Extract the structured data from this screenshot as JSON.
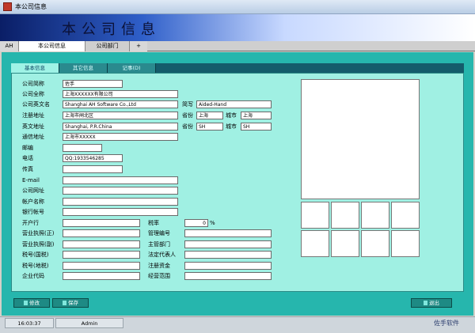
{
  "window": {
    "title": "本公司信息"
  },
  "banner": {
    "title": "本公司信息"
  },
  "main_tabs": [
    {
      "label": "AH"
    },
    {
      "label": "本公司信息"
    },
    {
      "label": "公司部门"
    },
    {
      "label": "+"
    }
  ],
  "sub_tabs": [
    {
      "label": "基本信息"
    },
    {
      "label": "其它信息"
    },
    {
      "label": "记事(D)"
    }
  ],
  "fields": {
    "short_name": {
      "label": "公司简称",
      "value": "佐手"
    },
    "full_name": {
      "label": "公司全称",
      "value": "上海XXXXXX有限公司"
    },
    "english_name": {
      "label": "公司英文名",
      "value": "Shanghai AH Software Co.,Ltd"
    },
    "abbr": {
      "label": "简写",
      "value": "Aided-Hand"
    },
    "reg_address": {
      "label": "注册地址",
      "value": "上海市闸北区"
    },
    "reg_province": {
      "label": "省份",
      "value": "上海"
    },
    "reg_city": {
      "label": "城市",
      "value": "上海"
    },
    "en_address": {
      "label": "英文地址",
      "value": "Shanghai, P.R.China"
    },
    "en_province": {
      "label": "省份",
      "value": "SH"
    },
    "en_city": {
      "label": "城市",
      "value": "SH"
    },
    "mail_address": {
      "label": "通信地址",
      "value": "上海市XXXXX"
    },
    "postcode": {
      "label": "邮编",
      "value": ""
    },
    "phone": {
      "label": "电话",
      "value": "QQ:1933546285"
    },
    "fax": {
      "label": "传真",
      "value": ""
    },
    "email": {
      "label": "E-mail",
      "value": ""
    },
    "website": {
      "label": "公司网址",
      "value": ""
    },
    "account_name": {
      "label": "帐户名称",
      "value": ""
    },
    "bank_account": {
      "label": "银行帐号",
      "value": ""
    },
    "bank": {
      "label": "开户行",
      "value": ""
    },
    "tax_rate": {
      "label": "税率",
      "value": "0",
      "unit": "%"
    },
    "license_main": {
      "label": "营业执照(正)",
      "value": ""
    },
    "mgmt_no": {
      "label": "管理编号",
      "value": ""
    },
    "license_copy": {
      "label": "营业执照(副)",
      "value": ""
    },
    "dept_in_charge": {
      "label": "主管部门",
      "value": ""
    },
    "tax_national": {
      "label": "税号(国税)",
      "value": ""
    },
    "legal_rep": {
      "label": "法定代表人",
      "value": ""
    },
    "tax_local": {
      "label": "税号(地税)",
      "value": ""
    },
    "reg_capital": {
      "label": "注册资金",
      "value": ""
    },
    "org_code": {
      "label": "企业代码",
      "value": ""
    },
    "business_scope": {
      "label": "经营范围",
      "value": ""
    }
  },
  "buttons": {
    "edit": "修改",
    "save": "保存",
    "exit": "退出"
  },
  "status": {
    "time": "16:03:37",
    "user": "Admin",
    "brand": "佐手软件"
  },
  "colors": {
    "panel": "#26b6ad",
    "form_bg": "#a0f0e3",
    "banner_dark": "#0a1e66"
  }
}
